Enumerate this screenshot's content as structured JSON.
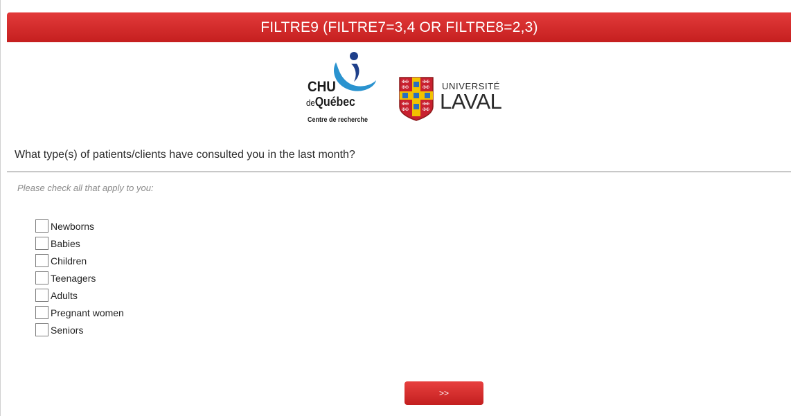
{
  "header": {
    "title": "FILTRE9 (FILTRE7=3,4 OR FILTRE8=2,3)"
  },
  "logos": {
    "chu": {
      "line1": "CHU",
      "line2_prefix": "de",
      "line2_main": "Québec",
      "line3": "Centre de recherche"
    },
    "laval": {
      "line1": "UNIVERSITÉ",
      "line2": "LAVAL"
    }
  },
  "question": {
    "text": "What type(s) of patients/clients have consulted you in the last month?",
    "hint": "Please check all that apply to you:",
    "options": [
      "Newborns",
      "Babies",
      "Children",
      "Teenagers",
      "Adults",
      "Pregnant women",
      "Seniors"
    ]
  },
  "navigation": {
    "next_label": ">>"
  },
  "colors": {
    "accent": "#d32f2f",
    "chu_blue": "#1e88c8",
    "laval_red": "#c8202f",
    "laval_gold": "#f2c200"
  }
}
